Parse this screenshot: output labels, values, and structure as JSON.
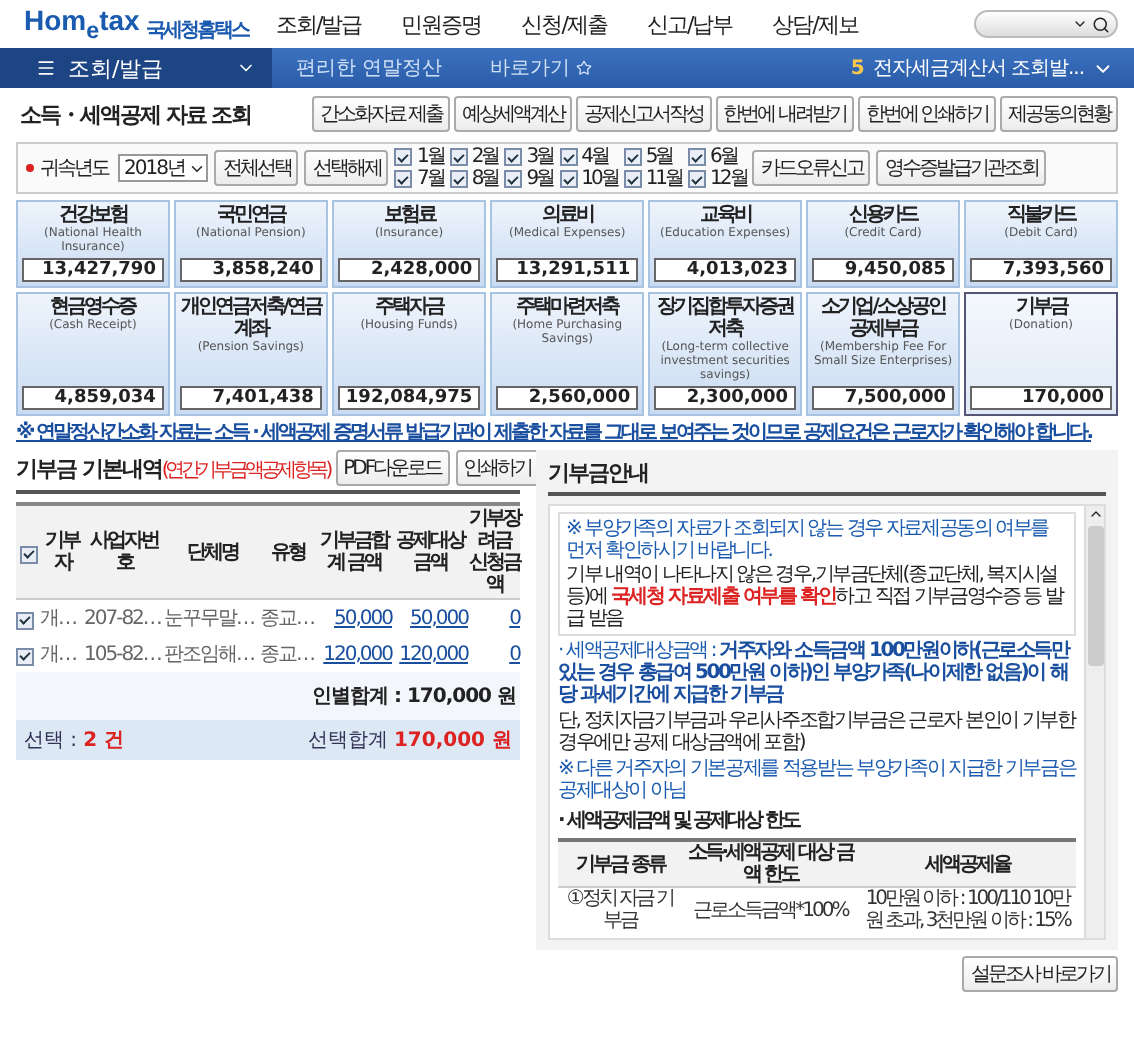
{
  "header": {
    "logo": "Hom$_{e}$tax",
    "logo_sub": "국세청홈택스",
    "nav": [
      "조회/발급",
      "민원증명",
      "신청/제출",
      "신고/납부",
      "상담/제보"
    ]
  },
  "menubar": {
    "menu": "조회/발급",
    "crumbs": [
      "편리한 연말정산",
      "바로가기"
    ],
    "alert_count": "5",
    "alert": "전자세금계산서 조회발..."
  },
  "page": {
    "title": "소득・세액공제 자료 조회",
    "actions": [
      "간소화자료 제출",
      "예상세액계산",
      "공제신고서작성",
      "한번에 내려받기",
      "한번에 인쇄하기",
      "제공동의현황"
    ]
  },
  "filter": {
    "label": "귀속년도",
    "year": "2018년",
    "buttons": [
      "전체선택",
      "선택해제"
    ],
    "months": [
      {
        "label": "1월",
        "checked": true
      },
      {
        "label": "2월",
        "checked": true
      },
      {
        "label": "3월",
        "checked": true
      },
      {
        "label": "4월",
        "checked": true
      },
      {
        "label": "5월",
        "checked": true
      },
      {
        "label": "6월",
        "checked": true
      },
      {
        "label": "7월",
        "checked": true
      },
      {
        "label": "8월",
        "checked": true
      },
      {
        "label": "9월",
        "checked": true
      },
      {
        "label": "10월",
        "checked": true
      },
      {
        "label": "11월",
        "checked": true
      },
      {
        "label": "12월",
        "checked": true
      }
    ],
    "tools": [
      "카드오류신고",
      "영수증발급기관조회"
    ]
  },
  "cards": [
    {
      "label": "건강보험",
      "english": "(National Health Insurance)",
      "amount": "13,427,790",
      "selected": false
    },
    {
      "label": "국민연금",
      "english": "(National Pension)",
      "amount": "3,858,240",
      "selected": false
    },
    {
      "label": "보험료",
      "english": "(Insurance)",
      "amount": "2,428,000",
      "selected": false
    },
    {
      "label": "의료비",
      "english": "(Medical Expenses)",
      "amount": "13,291,511",
      "selected": false
    },
    {
      "label": "교육비",
      "english": "(Education Expenses)",
      "amount": "4,013,023",
      "selected": false
    },
    {
      "label": "신용카드",
      "english": "(Credit Card)",
      "amount": "9,450,085",
      "selected": false
    },
    {
      "label": "직불카드",
      "english": "(Debit Card)",
      "amount": "7,393,560",
      "selected": false
    },
    {
      "label": "현금영수증",
      "english": "(Cash Receipt)",
      "amount": "4,859,034",
      "selected": false
    },
    {
      "label": "개인연금저축/연금계좌",
      "english": "(Pension Savings)",
      "amount": "7,401,438",
      "selected": false
    },
    {
      "label": "주택자금",
      "english": "(Housing Funds)",
      "amount": "192,084,975",
      "selected": false
    },
    {
      "label": "주택마련저축",
      "english": "(Home Purchasing Savings)",
      "amount": "2,560,000",
      "selected": false
    },
    {
      "label": "장기집합투자증권저축",
      "english": "(Long-term collective investment securities savings)",
      "amount": "2,300,000",
      "selected": false
    },
    {
      "label": "소기업/소상공인 공제부금",
      "english": "(Membership Fee For Small Size Enterprises)",
      "amount": "7,500,000",
      "selected": false
    },
    {
      "label": "기부금",
      "english": "(Donation)",
      "amount": "170,000",
      "selected": true
    }
  ],
  "notice": "※ 연말정산간소화 자료는 소득 · 세액공제 증명서류 발급기관이 제출한 자료를 그대로 보여주는 것이므로 공제요건은 근로자가 확인해야 합니다.",
  "donations": {
    "title": "기부금 기본내역",
    "subtitle": "(연간기부금액공제항목)",
    "buttons": [
      "PDF다운로드",
      "인쇄하기"
    ],
    "columns": [
      "기부자",
      "사업자번호",
      "단체명",
      "유형",
      "기부금합계 금액",
      "공제대상 금액",
      "기부장려금 신청금액"
    ],
    "all_checked": true,
    "rows": [
      {
        "checked": true,
        "cells": [
          "개…",
          "207-82…",
          "눈꾸무말…",
          "종교…",
          "50,000",
          "50,000",
          "0"
        ]
      },
      {
        "checked": true,
        "cells": [
          "개…",
          "105-82…",
          "판조임해…",
          "종교…",
          "120,000",
          "120,000",
          "0"
        ]
      }
    ],
    "person_total": "인별합계 : 170,000 원",
    "selected_label": "선택 :",
    "selected_count": "2 건",
    "selected_total_label": "선택합계",
    "selected_total": "170,000 원"
  },
  "guide": {
    "title": "기부금안내",
    "box": [
      {
        "kind": "note",
        "text": "※ 부양가족의 자료가 조회되지 않는 경우 자료제공동의 여부를 먼저 확인하시기 바랍니다."
      },
      {
        "kind": "plain",
        "text": "기부 내역이 나타나지 않은 경우,기부금단체(종교단체, 복지시설 등)에 **국세청 자료제출 여부를 확인**하고 직접 기부금영수증 등 발급 받음"
      }
    ],
    "items": [
      {
        "kind": "bullet",
        "text": "· 세액공제대상금액 : **거주자와 소득금액 100만원이하(근로소득만 있는 경우 총급여 500만원 이하)인 부양가족(나이제한 없음)이 해당 과세기간에 지급한 기부금**"
      },
      {
        "kind": "plain",
        "text": "단, 정치자금기부금과 우리사주조합기부금은 근로자 본인이 기부한 경우에만 공제 대상금액에 포함)"
      },
      {
        "kind": "note",
        "text": "※ 다른 거주자의 기본공제를 적용받는 부양가족이 지급한 기부금은 공제대상이 아님"
      }
    ],
    "limit_title": "· 세액공제금액 및 공제대상 한도",
    "limit_columns": [
      "기부금 종류",
      "소득·세액공제 대상 금액 한도",
      "세액공제율"
    ],
    "limit_rows": [
      [
        "①정치 자금 기부금",
        "근로소득금액*100%",
        "10만원 이하 : 100/110 10만원 초과, 3천만원 이하 : 15%"
      ]
    ]
  },
  "survey_button": "설문조사 바로가기"
}
